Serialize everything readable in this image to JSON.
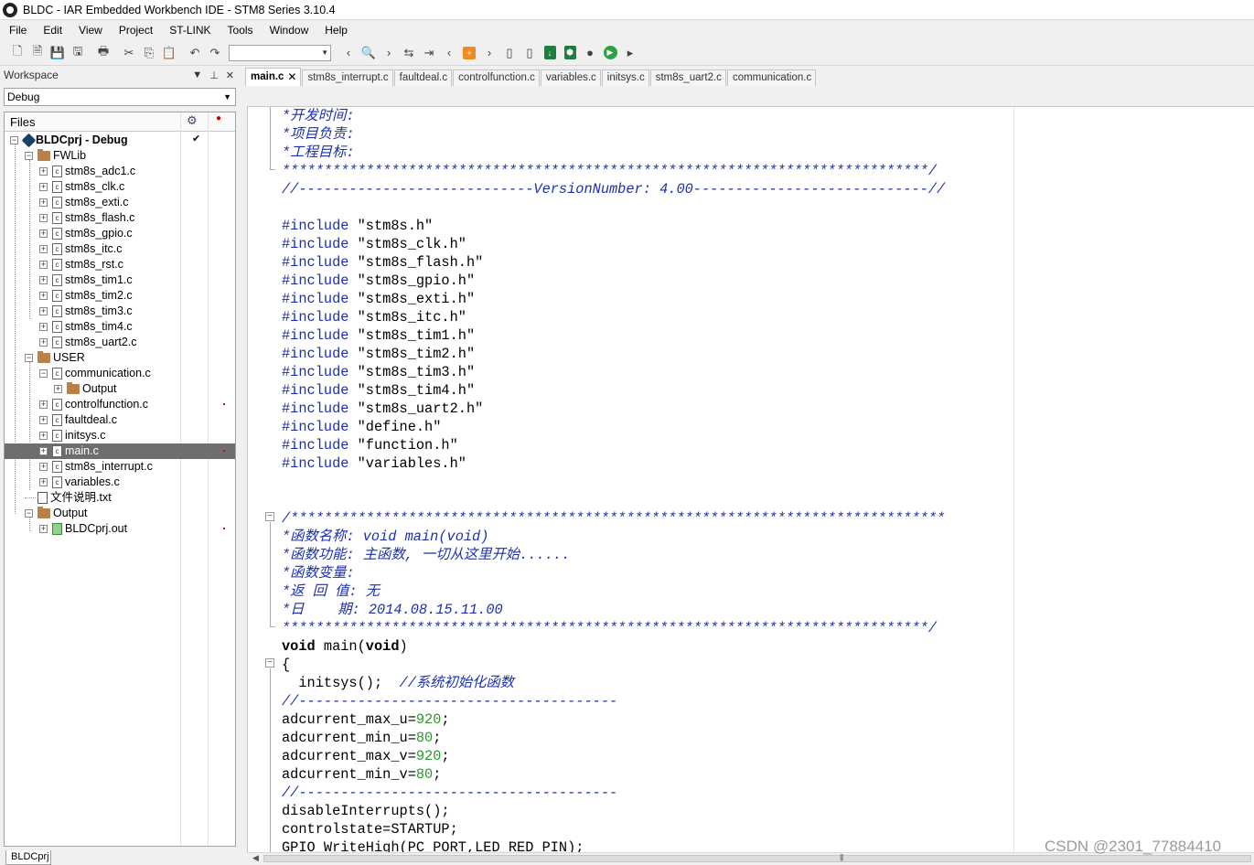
{
  "window": {
    "title": "BLDC - IAR Embedded Workbench IDE - STM8 Series 3.10.4"
  },
  "menu": [
    "File",
    "Edit",
    "View",
    "Project",
    "ST-LINK",
    "Tools",
    "Window",
    "Help"
  ],
  "workspace": {
    "header": "Workspace",
    "configuration": "Debug",
    "files_header": "Files",
    "bottom_tab": "BLDCprj"
  },
  "tree": [
    {
      "label": "BLDCprj - Debug",
      "type": "project",
      "level": 0,
      "expanded": true,
      "checked": true
    },
    {
      "label": "FWLib",
      "type": "folder",
      "level": 1,
      "expanded": true
    },
    {
      "label": "stm8s_adc1.c",
      "type": "file",
      "level": 2
    },
    {
      "label": "stm8s_clk.c",
      "type": "file",
      "level": 2
    },
    {
      "label": "stm8s_exti.c",
      "type": "file",
      "level": 2
    },
    {
      "label": "stm8s_flash.c",
      "type": "file",
      "level": 2
    },
    {
      "label": "stm8s_gpio.c",
      "type": "file",
      "level": 2
    },
    {
      "label": "stm8s_itc.c",
      "type": "file",
      "level": 2
    },
    {
      "label": "stm8s_rst.c",
      "type": "file",
      "level": 2
    },
    {
      "label": "stm8s_tim1.c",
      "type": "file",
      "level": 2
    },
    {
      "label": "stm8s_tim2.c",
      "type": "file",
      "level": 2
    },
    {
      "label": "stm8s_tim3.c",
      "type": "file",
      "level": 2
    },
    {
      "label": "stm8s_tim4.c",
      "type": "file",
      "level": 2
    },
    {
      "label": "stm8s_uart2.c",
      "type": "file",
      "level": 2
    },
    {
      "label": "USER",
      "type": "folder",
      "level": 1,
      "expanded": true
    },
    {
      "label": "communication.c",
      "type": "file",
      "level": 2,
      "expanded": true
    },
    {
      "label": "Output",
      "type": "folder",
      "level": 3
    },
    {
      "label": "controlfunction.c",
      "type": "file",
      "level": 2,
      "dot": true
    },
    {
      "label": "faultdeal.c",
      "type": "file",
      "level": 2
    },
    {
      "label": "initsys.c",
      "type": "file",
      "level": 2
    },
    {
      "label": "main.c",
      "type": "file",
      "level": 2,
      "selected": true,
      "dot": true
    },
    {
      "label": "stm8s_interrupt.c",
      "type": "file",
      "level": 2
    },
    {
      "label": "variables.c",
      "type": "file",
      "level": 2
    },
    {
      "label": "文件说明.txt",
      "type": "txt",
      "level": 1
    },
    {
      "label": "Output",
      "type": "folder",
      "level": 1,
      "expanded": true
    },
    {
      "label": "BLDCprj.out",
      "type": "out",
      "level": 2,
      "dot": true
    }
  ],
  "tabs": [
    "main.c",
    "stm8s_interrupt.c",
    "faultdeal.c",
    "controlfunction.c",
    "variables.c",
    "initsys.c",
    "stm8s_uart2.c",
    "communication.c"
  ],
  "code": [
    [
      {
        "t": "*开发时间:",
        "c": "comment"
      }
    ],
    [
      {
        "t": "*项目负责:",
        "c": "comment"
      }
    ],
    [
      {
        "t": "*工程目标:",
        "c": "comment"
      }
    ],
    [
      {
        "t": "*****************************************************************************/",
        "c": "comment"
      }
    ],
    [
      {
        "t": "//----------------------------VersionNumber: 4.00----------------------------//",
        "c": "comment"
      }
    ],
    [],
    [
      {
        "t": "#include ",
        "c": "pre"
      },
      {
        "t": "\"stm8s.h\"",
        "c": ""
      }
    ],
    [
      {
        "t": "#include ",
        "c": "pre"
      },
      {
        "t": "\"stm8s_clk.h\"",
        "c": ""
      }
    ],
    [
      {
        "t": "#include ",
        "c": "pre"
      },
      {
        "t": "\"stm8s_flash.h\"",
        "c": ""
      }
    ],
    [
      {
        "t": "#include ",
        "c": "pre"
      },
      {
        "t": "\"stm8s_gpio.h\"",
        "c": ""
      }
    ],
    [
      {
        "t": "#include ",
        "c": "pre"
      },
      {
        "t": "\"stm8s_exti.h\"",
        "c": ""
      }
    ],
    [
      {
        "t": "#include ",
        "c": "pre"
      },
      {
        "t": "\"stm8s_itc.h\"",
        "c": ""
      }
    ],
    [
      {
        "t": "#include ",
        "c": "pre"
      },
      {
        "t": "\"stm8s_tim1.h\"",
        "c": ""
      }
    ],
    [
      {
        "t": "#include ",
        "c": "pre"
      },
      {
        "t": "\"stm8s_tim2.h\"",
        "c": ""
      }
    ],
    [
      {
        "t": "#include ",
        "c": "pre"
      },
      {
        "t": "\"stm8s_tim3.h\"",
        "c": ""
      }
    ],
    [
      {
        "t": "#include ",
        "c": "pre"
      },
      {
        "t": "\"stm8s_tim4.h\"",
        "c": ""
      }
    ],
    [
      {
        "t": "#include ",
        "c": "pre"
      },
      {
        "t": "\"stm8s_uart2.h\"",
        "c": ""
      }
    ],
    [
      {
        "t": "#include ",
        "c": "pre"
      },
      {
        "t": "\"define.h\"",
        "c": ""
      }
    ],
    [
      {
        "t": "#include ",
        "c": "pre"
      },
      {
        "t": "\"function.h\"",
        "c": ""
      }
    ],
    [
      {
        "t": "#include ",
        "c": "pre"
      },
      {
        "t": "\"variables.h\"",
        "c": ""
      }
    ],
    [],
    [],
    [
      {
        "t": "/******************************************************************************",
        "c": "comment"
      }
    ],
    [
      {
        "t": "*函数名称: void main(void)",
        "c": "comment"
      }
    ],
    [
      {
        "t": "*函数功能: 主函数, 一切从这里开始......",
        "c": "comment"
      }
    ],
    [
      {
        "t": "*函数变量:",
        "c": "comment"
      }
    ],
    [
      {
        "t": "*返 回 值: 无",
        "c": "comment"
      }
    ],
    [
      {
        "t": "*日    期: 2014.08.15.11.00",
        "c": "comment"
      }
    ],
    [
      {
        "t": "*****************************************************************************/",
        "c": "comment"
      }
    ],
    [
      {
        "t": "void",
        "c": "kw"
      },
      {
        "t": " main(",
        "c": ""
      },
      {
        "t": "void",
        "c": "kw"
      },
      {
        "t": ")",
        "c": ""
      }
    ],
    [
      {
        "t": "{",
        "c": ""
      }
    ],
    [
      {
        "t": "  initsys();  ",
        "c": ""
      },
      {
        "t": "//系统初始化函数",
        "c": "comment"
      }
    ],
    [
      {
        "t": "//--------------------------------------",
        "c": "comment"
      }
    ],
    [
      {
        "t": "adcurrent_max_u=",
        "c": ""
      },
      {
        "t": "920",
        "c": "num"
      },
      {
        "t": ";",
        "c": ""
      }
    ],
    [
      {
        "t": "adcurrent_min_u=",
        "c": ""
      },
      {
        "t": "80",
        "c": "num"
      },
      {
        "t": ";",
        "c": ""
      }
    ],
    [
      {
        "t": "adcurrent_max_v=",
        "c": ""
      },
      {
        "t": "920",
        "c": "num"
      },
      {
        "t": ";",
        "c": ""
      }
    ],
    [
      {
        "t": "adcurrent_min_v=",
        "c": ""
      },
      {
        "t": "80",
        "c": "num"
      },
      {
        "t": ";",
        "c": ""
      }
    ],
    [
      {
        "t": "//--------------------------------------",
        "c": "comment"
      }
    ],
    [
      {
        "t": "disableInterrupts();",
        "c": ""
      }
    ],
    [
      {
        "t": "controlstate=STARTUP;",
        "c": ""
      }
    ],
    [
      {
        "t": "GPIO_WriteHigh(PC_PORT,LED_RED_PIN);",
        "c": ""
      }
    ]
  ],
  "watermark": "CSDN @2301_77884410",
  "colors": {
    "comment": "#1c2fae",
    "number": "#2a9a2a",
    "selection": "#6e6e6e"
  }
}
